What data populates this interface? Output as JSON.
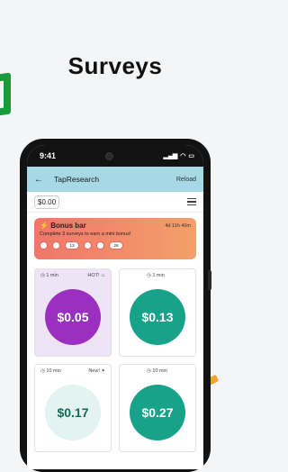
{
  "headline": "Surveys",
  "status_bar": {
    "time": "9:41"
  },
  "app_bar": {
    "back_icon": "arrow-left-icon",
    "title": "TapResearch",
    "reload": "Reload"
  },
  "balance": "$0.00",
  "bonus": {
    "title": "Bonus bar",
    "timer": "4d 11h 40m",
    "description": "Complete 3 surveys to earn a mini bonus!",
    "steps": [
      "",
      "",
      "13",
      "",
      "",
      "26"
    ]
  },
  "surveys": [
    {
      "time": "1 min",
      "tag": "HOT!",
      "amount": "$0.05",
      "color": "#9b2fc0",
      "text_color": "#ffffff"
    },
    {
      "time": "1 min",
      "tag": "",
      "amount": "$0.13",
      "color": "#18a28a",
      "text_color": "#ffffff"
    },
    {
      "time": "10 min",
      "tag": "New!",
      "amount": "$0.17",
      "color": "#e3f3ef",
      "text_color": "#116b5a"
    },
    {
      "time": "10 min",
      "tag": "",
      "amount": "$0.27",
      "color": "#18a28a",
      "text_color": "#ffffff"
    }
  ]
}
